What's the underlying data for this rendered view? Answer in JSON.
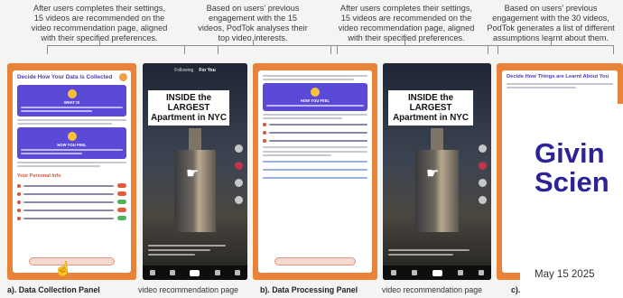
{
  "captions": [
    [
      "After users completes their settings,",
      "15 videos are recommended on the",
      "video recommendation page, aligned",
      "with their specified preferences."
    ],
    [
      "Based on users' previous",
      "engagement with the 15",
      "videos, PodTok analyses their",
      "top video interests."
    ],
    [
      "After users completes their settings,",
      "15 videos are recommended on the",
      "video recommendation page, aligned",
      "with their specified preferences."
    ],
    [
      "Based on users' previous",
      "engagement with the 30 videos,",
      "PodTok generates a list of different",
      "assumptions learnt about them."
    ]
  ],
  "panel_a": {
    "title": "Decide How Your Data is Collected",
    "card1_label": "WHAT IS",
    "card2_label": "HOW YOU FEEL",
    "section": "Your Personal Info"
  },
  "panel_b": {
    "card_label": "HOW YOU FEEL"
  },
  "panel_c": {
    "title": "Decide How Things are Learnt About You"
  },
  "video": {
    "headline_1": "INSIDE the LARGEST",
    "headline_2": "Apartment in NYC",
    "tab_following": "Following",
    "tab_for_you": "For You"
  },
  "overlay": {
    "title_1": "Givin",
    "title_2": "Scien",
    "date": "May 15 2025"
  },
  "bottom_labels": {
    "a": "a). Data Collection Panel",
    "vr1": "video recommendation page",
    "b": "b). Data Processing Panel",
    "vr2": "video recommendation page",
    "c": "c)."
  }
}
